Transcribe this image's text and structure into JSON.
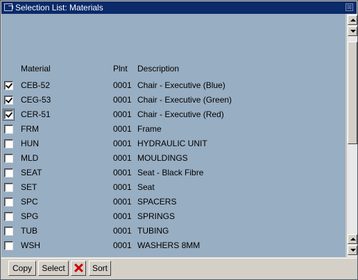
{
  "window": {
    "title": "Selection List: Materials",
    "close_glyph": "⊠"
  },
  "columns": {
    "material": "Material",
    "plnt": "Plnt",
    "description": "Description"
  },
  "rows": [
    {
      "checked": true,
      "material": "CEB-52",
      "plnt": "0001",
      "description": "Chair - Executive (Blue)"
    },
    {
      "checked": true,
      "material": "CEG-53",
      "plnt": "0001",
      "description": "Chair - Executive (Green)"
    },
    {
      "checked": true,
      "material": "CER-51",
      "plnt": "0001",
      "description": "Chair - Executive (Red)"
    },
    {
      "checked": false,
      "material": "FRM",
      "plnt": "0001",
      "description": "Frame"
    },
    {
      "checked": false,
      "material": "HUN",
      "plnt": "0001",
      "description": "HYDRAULIC UNIT"
    },
    {
      "checked": false,
      "material": "MLD",
      "plnt": "0001",
      "description": "MOULDINGS"
    },
    {
      "checked": false,
      "material": "SEAT",
      "plnt": "0001",
      "description": "Seat - Black Fibre"
    },
    {
      "checked": false,
      "material": "SET",
      "plnt": "0001",
      "description": "Seat"
    },
    {
      "checked": false,
      "material": "SPC",
      "plnt": "0001",
      "description": "SPACERS"
    },
    {
      "checked": false,
      "material": "SPG",
      "plnt": "0001",
      "description": "SPRINGS"
    },
    {
      "checked": false,
      "material": "TUB",
      "plnt": "0001",
      "description": "TUBING"
    },
    {
      "checked": false,
      "material": "WSH",
      "plnt": "0001",
      "description": "WASHERS 8MM"
    }
  ],
  "toolbar": {
    "copy": "Copy",
    "select": "Select",
    "delete_icon": "delete-icon",
    "sort": "Sort"
  },
  "colors": {
    "list_background": "#98aec2",
    "titlebar": "#0a2a6a",
    "delete_red": "#d00000"
  }
}
